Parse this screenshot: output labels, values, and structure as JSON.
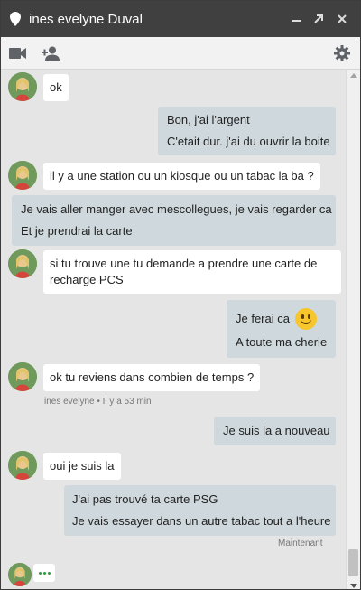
{
  "window": {
    "title": "ines evelyne Duval",
    "colors": {
      "titlebar": "#404040",
      "incoming": "#ffffff",
      "outgoing": "#cfd8dc",
      "background": "#e5e5e5",
      "typing_dots": "#2e9b3c"
    }
  },
  "titlebar": {
    "icons": [
      "location-pin-icon",
      "minimize-icon",
      "popout-icon",
      "close-icon"
    ]
  },
  "toolbar": {
    "icons": [
      "video-call-icon",
      "add-person-icon",
      "settings-gear-icon"
    ]
  },
  "messages": [
    {
      "from": "contact",
      "lines": [
        "ok"
      ]
    },
    {
      "from": "me",
      "lines": [
        "Bon, j'ai l'argent",
        "C'etait dur. j'ai du ouvrir la boite"
      ]
    },
    {
      "from": "contact",
      "lines": [
        "il y a une station ou un kiosque ou un tabac la ba ?"
      ]
    },
    {
      "from": "me",
      "lines": [
        "Je vais aller manger avec mescollegues, je vais regarder ca",
        "Et je prendrai la carte"
      ]
    },
    {
      "from": "contact",
      "lines": [
        "si tu trouve une tu demande a prendre une carte de",
        "recharge PCS"
      ]
    },
    {
      "from": "me",
      "lines": [
        "Je ferai ca",
        "A toute ma cherie"
      ],
      "emoji": "smiley-emoji-icon"
    },
    {
      "from": "contact",
      "lines": [
        "ok tu reviens dans combien de temps ?"
      ],
      "meta": "ines evelyne • Il y a 53 min"
    },
    {
      "from": "me",
      "lines": [
        "Je suis la a nouveau"
      ]
    },
    {
      "from": "contact",
      "lines": [
        "oui je suis la"
      ]
    },
    {
      "from": "me",
      "lines": [
        "J'ai pas trouvé ta carte PSG",
        "Je vais essayer dans un autre tabac tout a l'heure"
      ],
      "meta": "Maintenant"
    }
  ],
  "typing_indicator": "..."
}
